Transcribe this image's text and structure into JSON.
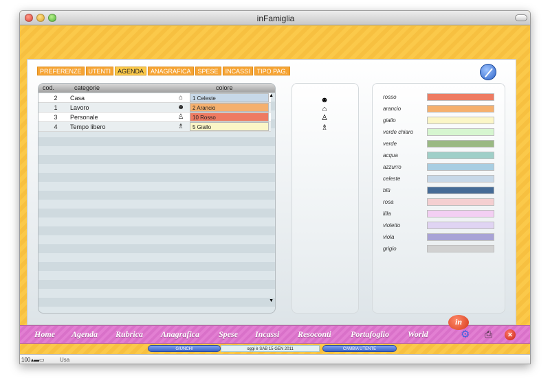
{
  "window": {
    "title": "inFamiglia"
  },
  "tabs": [
    "PREFERENZE",
    "UTENTI",
    "AGENDA",
    "ANAGRAFICA",
    "SPESE",
    "INCASSI",
    "TIPO PAG."
  ],
  "active_tab": "AGENDA",
  "table": {
    "headers": {
      "cod": "cod.",
      "categorie": "categorie",
      "colore": "colore"
    },
    "rows": [
      {
        "cod": "2",
        "categoria": "Casa",
        "icon": "house-icon",
        "colore": "1 Celeste",
        "color": "#c7d8e8"
      },
      {
        "cod": "1",
        "categoria": "Lavoro",
        "icon": "people-icon",
        "colore": "2 Arancio",
        "color": "#f5b06e"
      },
      {
        "cod": "3",
        "categoria": "Personale",
        "icon": "person-icon",
        "colore": "10 Rosso",
        "color": "#ee7b62"
      },
      {
        "cod": "4",
        "categoria": "Tempo libero",
        "icon": "couple-icon",
        "colore": "5 Giallo",
        "color": "#fbf6c7"
      }
    ]
  },
  "icon_column": [
    "people-icon",
    "house-icon",
    "person-icon",
    "couple-icon"
  ],
  "palette": [
    {
      "label": "rosso",
      "color": "#ee7b62"
    },
    {
      "label": "arancio",
      "color": "#f5b06e"
    },
    {
      "label": "giallo",
      "color": "#fbf6c7"
    },
    {
      "label": "verde chiaro",
      "color": "#d6f6d0"
    },
    {
      "label": "verde",
      "color": "#9ab983"
    },
    {
      "label": "acqua",
      "color": "#9fcfc8"
    },
    {
      "label": "azzurro",
      "color": "#a8cee2"
    },
    {
      "label": "celeste",
      "color": "#c7d8e8"
    },
    {
      "label": "blù",
      "color": "#456b96"
    },
    {
      "label": "rosa",
      "color": "#f4cfd1"
    },
    {
      "label": "lilla",
      "color": "#f3cff3"
    },
    {
      "label": "violetto",
      "color": "#e0d4f3"
    },
    {
      "label": "viola",
      "color": "#a8a3d6"
    },
    {
      "label": "grigio",
      "color": "#d1d1d1"
    }
  ],
  "nav": [
    "Home",
    "Agenda",
    "Rubrica",
    "Anagrafica",
    "Spese",
    "Incassi",
    "Resoconti",
    "Portafoglio",
    "World"
  ],
  "logo_text": "in",
  "status": {
    "user": "GIUNCHI",
    "today_label": "oggi è",
    "date": "SAB 15 GEN 2011",
    "change_user": "CAMBIA UTENTE"
  },
  "bottom": {
    "zoom": "100",
    "mode": "Usa"
  }
}
